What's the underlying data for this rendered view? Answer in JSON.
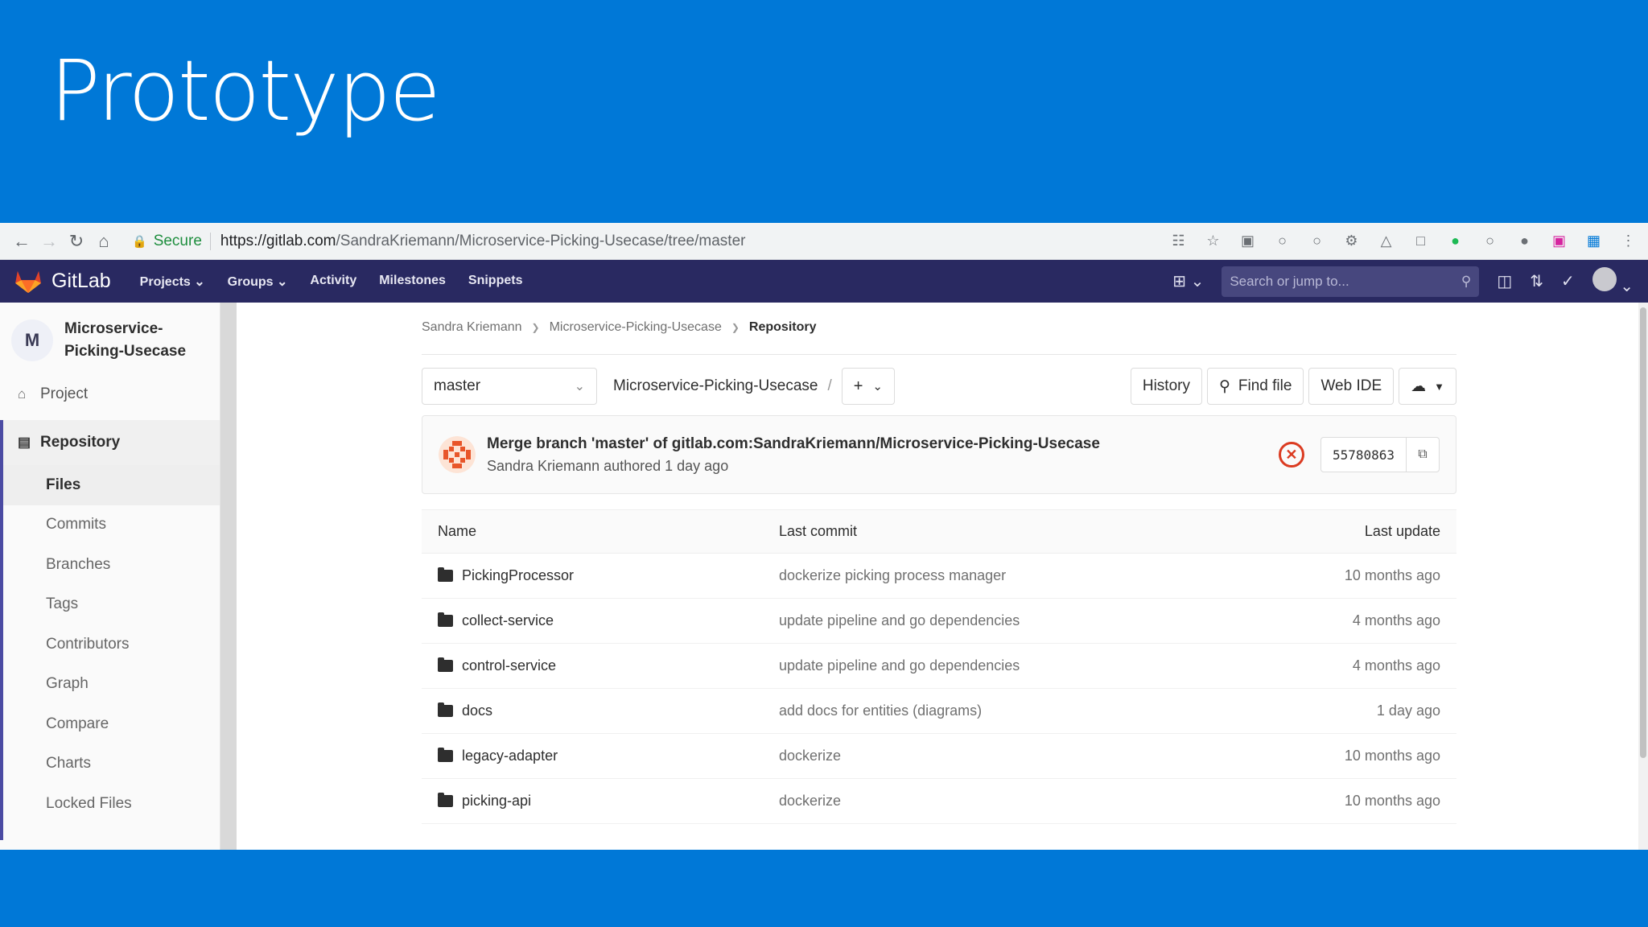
{
  "slide": {
    "title": "Prototype"
  },
  "browser": {
    "secure_label": "Secure",
    "url_host": "https://gitlab.com",
    "url_path": "/SandraKriemann/Microservice-Picking-Usecase/tree/master"
  },
  "gitlab_nav": {
    "logo_text": "GitLab",
    "menu": [
      "Projects",
      "Groups",
      "Activity",
      "Milestones",
      "Snippets"
    ],
    "search_placeholder": "Search or jump to..."
  },
  "sidebar": {
    "project_initial": "M",
    "project_name": "Microservice-Picking-Usecase",
    "project_label": "Project",
    "repository_label": "Repository",
    "subitems": [
      "Files",
      "Commits",
      "Branches",
      "Tags",
      "Contributors",
      "Graph",
      "Compare",
      "Charts",
      "Locked Files"
    ]
  },
  "breadcrumb": [
    "Sandra Kriemann",
    "Microservice-Picking-Usecase",
    "Repository"
  ],
  "tree_bar": {
    "branch": "master",
    "path": "Microservice-Picking-Usecase",
    "buttons": {
      "history": "History",
      "find_file": "Find file",
      "web_ide": "Web IDE"
    }
  },
  "last_commit": {
    "title": "Merge branch 'master' of gitlab.com:SandraKriemann/Microservice-Picking-Usecase",
    "author_line": "Sandra Kriemann authored 1 day ago",
    "sha": "55780863",
    "pipeline_status_color": "#db3b21"
  },
  "table": {
    "headers": {
      "name": "Name",
      "last_commit": "Last commit",
      "last_update": "Last update"
    },
    "rows": [
      {
        "name": "PickingProcessor",
        "commit": "dockerize picking process manager",
        "date": "10 months ago"
      },
      {
        "name": "collect-service",
        "commit": "update pipeline and go dependencies",
        "date": "4 months ago"
      },
      {
        "name": "control-service",
        "commit": "update pipeline and go dependencies",
        "date": "4 months ago"
      },
      {
        "name": "docs",
        "commit": "add docs for entities (diagrams)",
        "date": "1 day ago"
      },
      {
        "name": "legacy-adapter",
        "commit": "dockerize",
        "date": "10 months ago"
      },
      {
        "name": "picking-api",
        "commit": "dockerize",
        "date": "10 months ago"
      }
    ]
  },
  "colors": {
    "slide_bg": "#0078d7",
    "gitlab_nav": "#292961",
    "accent": "#4b4ba3"
  }
}
